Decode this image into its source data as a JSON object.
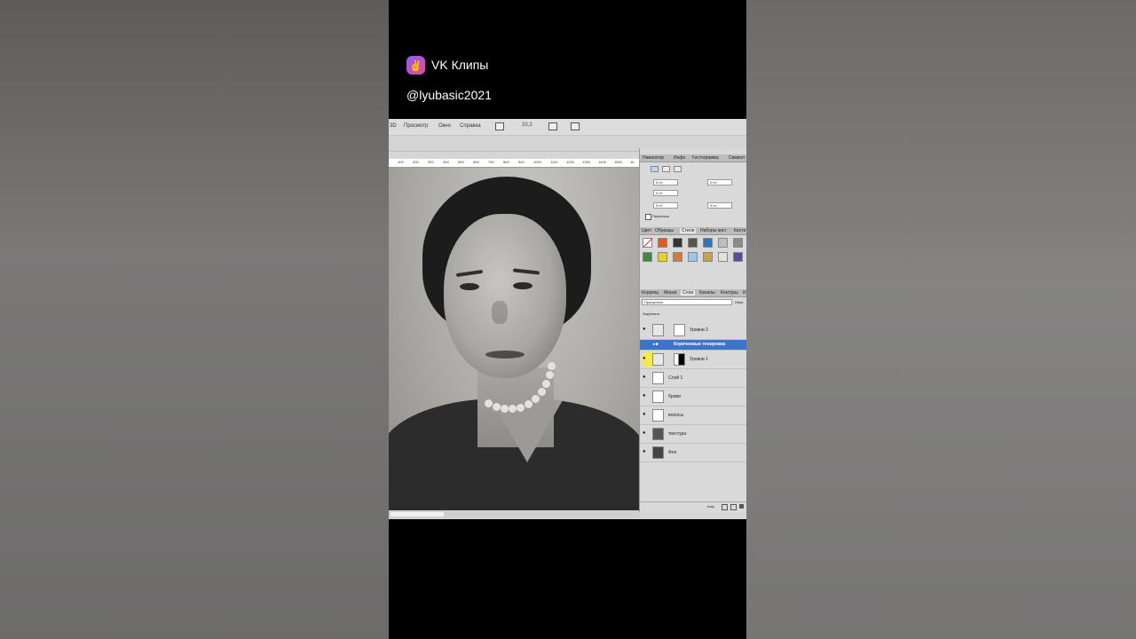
{
  "overlay": {
    "app_name": "VK Клипы",
    "username": "@lyubasic2021"
  },
  "photoshop": {
    "menu": [
      "3D",
      "Просмотр",
      "Окно",
      "Справка"
    ],
    "zoom": "33,3",
    "ruler_ticks": [
      "100",
      "200",
      "300",
      "400",
      "500",
      "600",
      "700",
      "800",
      "900",
      "1000",
      "1100",
      "1200",
      "1300",
      "1400",
      "1500",
      "16"
    ],
    "panel_tabs_top": [
      "Навигатор",
      "Инфо",
      "Гистограмма",
      "Символ"
    ],
    "paragraph": {
      "fields": [
        "0 пт",
        "0 пт",
        "0 пт",
        "0 пт",
        "0 пт"
      ],
      "hyphenation_label": "Переносы"
    },
    "panel_tabs_styles": [
      "Цвет",
      "Образцы",
      "Стили",
      "Наборы кист",
      "Кисти"
    ],
    "panel_tabs_layers": [
      "Коррекц",
      "Маски",
      "Слои",
      "Каналы",
      "Контуры",
      "И"
    ],
    "blend_mode": "Пропустить",
    "opacity_label": "Непр",
    "lock_label": "Закрепить:",
    "layers": [
      {
        "name": "Уровни 2",
        "type": "adjustment"
      },
      {
        "name": "Коричневые тенировка",
        "type": "group",
        "selected": true
      },
      {
        "name": "Уровни 1",
        "type": "adjustment"
      },
      {
        "name": "Слой 1",
        "type": "blank"
      },
      {
        "name": "брови",
        "type": "blank"
      },
      {
        "name": "волосы",
        "type": "blank"
      },
      {
        "name": "текстура",
        "type": "photo"
      },
      {
        "name": "Фон",
        "type": "photo"
      }
    ],
    "bottom_label": "ноф"
  }
}
